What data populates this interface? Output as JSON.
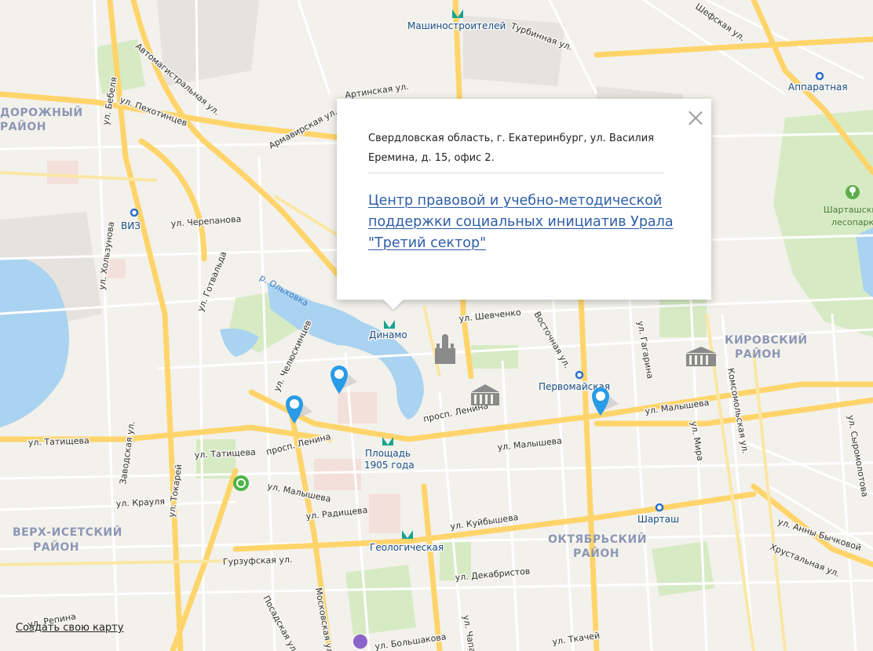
{
  "map": {
    "districts": [
      "ДОРОЖНЫЙ",
      "РАЙОН",
      "КИРОВСКИЙ",
      "РАЙОН",
      "ВЕРХ-ИСЕТСКИЙ",
      "РАЙОН",
      "ОКТЯБРЬСКИЙ",
      "РАЙОН"
    ],
    "metro": [
      "Машиностроителей",
      "Динамо",
      "Площадь",
      "1905 года",
      "Геологическая"
    ],
    "stations": [
      "Аппаратная",
      "ВИЗ",
      "Первомайская",
      "Шарташ"
    ],
    "streets": [
      "Шефская ул.",
      "Турбинная ул.",
      "Автомагистральная ул.",
      "ул. Бебеля",
      "ул. Пехотинцев",
      "Артинская ул.",
      "Армавирская ул.",
      "ул. Черепанова",
      "ул. Хользунова",
      "ул. Готвальда",
      "ул. Челюскинцев",
      "ул. Шевченко",
      "Восточная ул.",
      "ул. Гагарина",
      "ул. Малышева",
      "просп. Ленина",
      "ул. Татищева",
      "Заводская ул.",
      "ул. Токарей",
      "ул. Крауля",
      "ул. Радищева",
      "ул. Куйбышева",
      "Гурзуфская ул.",
      "ул. Декабристов",
      "Московская ул.",
      "Посадская ул.",
      "ул. Большакова",
      "ул. Чапаева",
      "ул. Ткачей",
      "ул. Мира",
      "Комсомольская ул.",
      "ул. Анны Бычковой",
      "Хрустальная ул.",
      "ул. Сыромолотова",
      "ул. Репина"
    ],
    "water": [
      "р. Ольховка"
    ],
    "parks": [
      "Шарташский",
      "лесопарк"
    ]
  },
  "balloon": {
    "address": "Свердловская область, г. Екатеринбург, ул. Василия Еремина, д. 15, офис 2.",
    "link": "Центр правовой и учебно-методической поддержки социальных инициатив Урала \"Третий сектор\""
  },
  "markers": [
    "location-marker",
    "location-marker",
    "location-marker"
  ],
  "footer": {
    "create_map": "Создать свою карту"
  },
  "colors": {
    "water": "#a9d3f0",
    "park": "#cde8b8",
    "major_road": "#ffd56b",
    "marker": "#2a9be6",
    "link": "#2d5ea8"
  }
}
